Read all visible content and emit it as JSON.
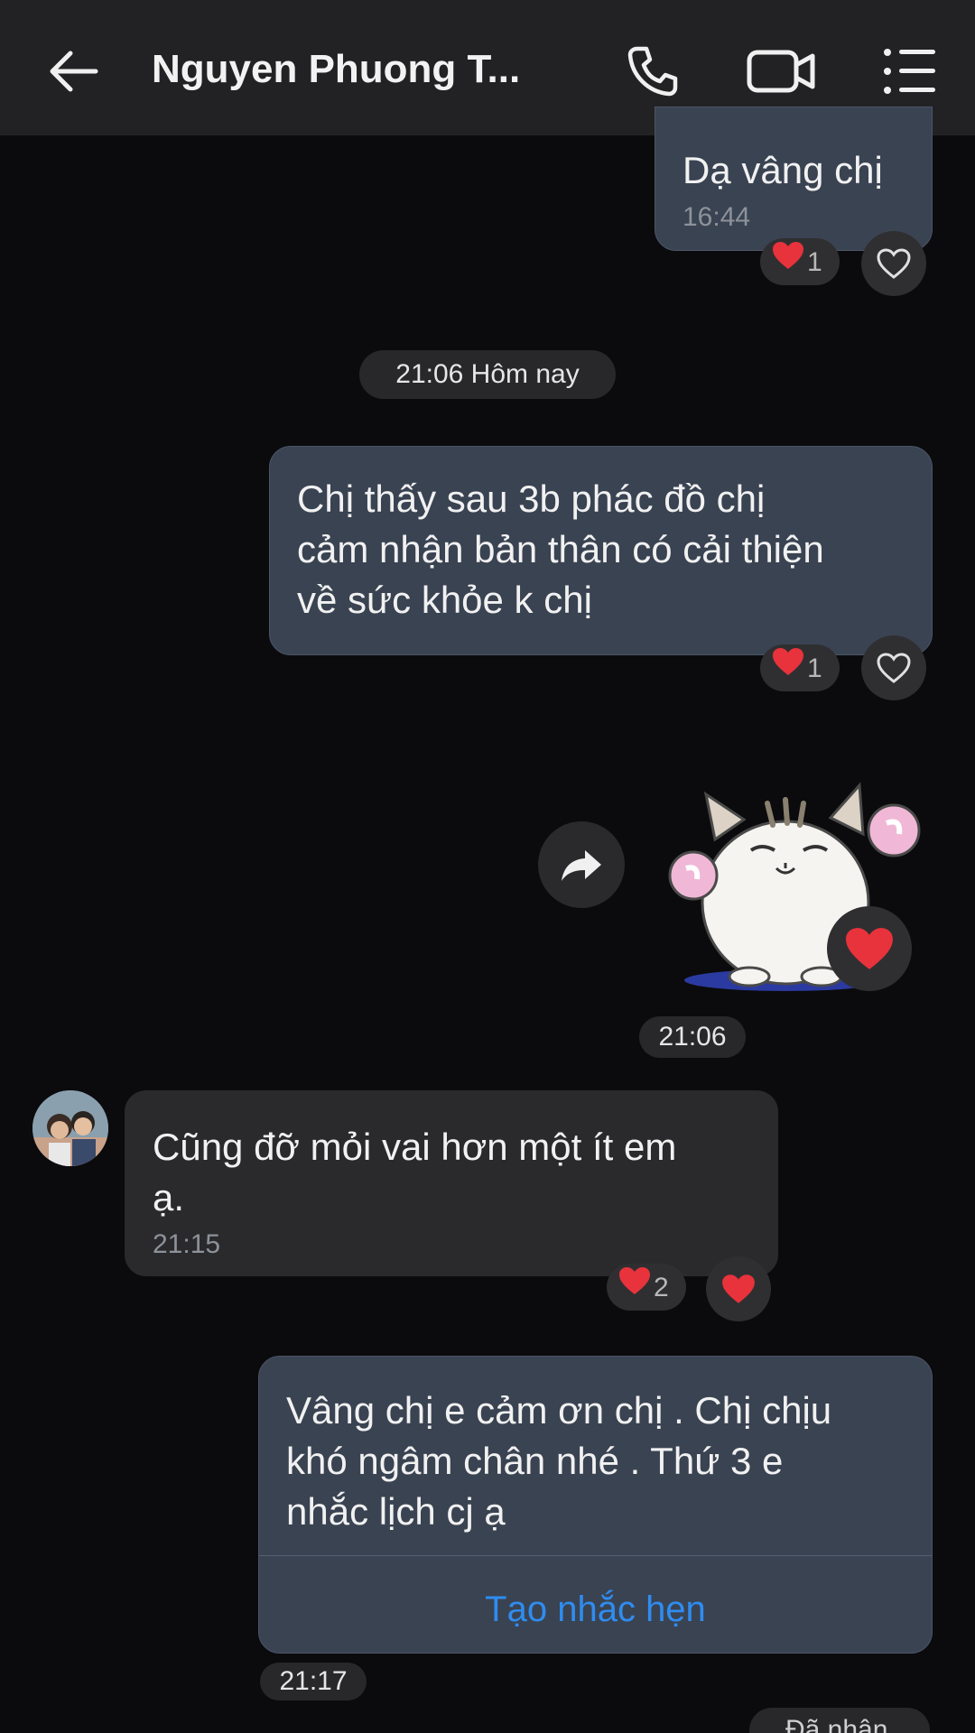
{
  "header": {
    "title": "Nguyen Phuong T...",
    "icons": [
      "back-arrow-icon",
      "phone-icon",
      "video-call-icon",
      "menu-list-icon"
    ]
  },
  "messages": [
    {
      "text": "Dạ vâng chị",
      "time": "16:44",
      "reaction_count": "1"
    },
    {
      "text": "Chị thấy sau 3b phác đồ chị\ncảm nhận bản thân có cải thiện\nvề sức khỏe k chị",
      "reaction_count": "1"
    },
    {
      "text": "Cũng đỡ mỏi vai hơn một ít em\nạ.",
      "time": "21:15",
      "reaction_count": "2"
    },
    {
      "text": "Vâng chị e cảm ơn chị . Chị chịu\nkhó ngâm chân nhé . Thứ 3 e\nnhắc lịch cj ạ",
      "action": "Tạo nhắc hẹn"
    }
  ],
  "separators": {
    "date": "21:06 Hôm nay",
    "sticker_time": "21:06",
    "last_time": "21:17"
  },
  "status": {
    "seen": "Đã nhận"
  },
  "colors": {
    "header_bg": "#222224",
    "sent_bubble": "#3a4352",
    "received_bubble": "#2a2a2c",
    "link": "#2f8cf0",
    "heart": "#e8323c"
  }
}
